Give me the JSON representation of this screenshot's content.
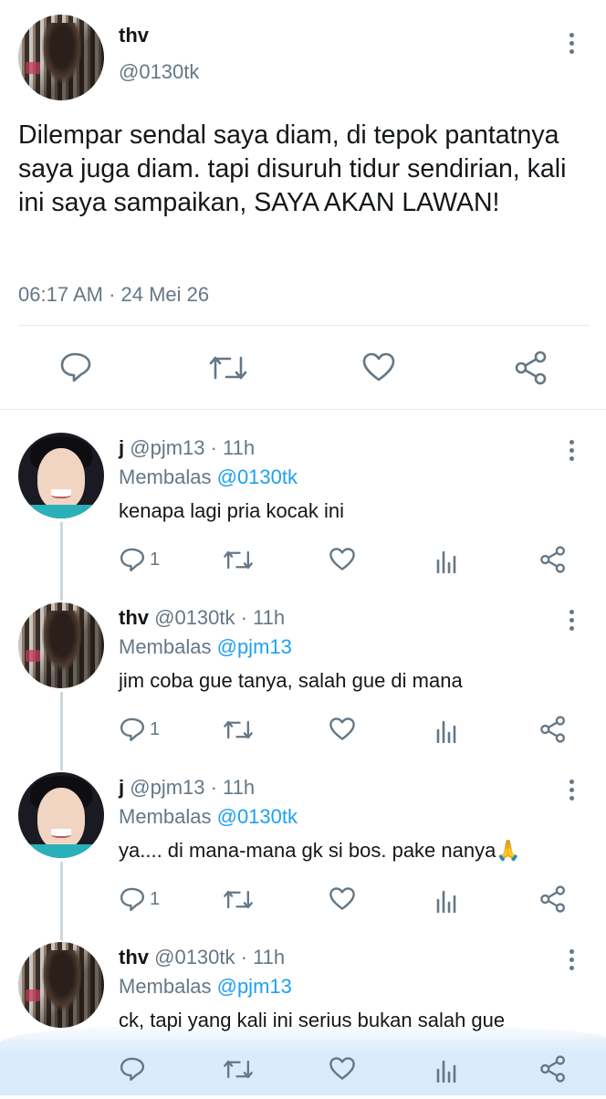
{
  "main_tweet": {
    "name": "thv",
    "handle": "@0130tk",
    "text": "Dilempar sendal saya diam, di tepok pantatnya saya juga diam. tapi disuruh tidur sendirian, kali ini saya sampaikan, SAYA AKAN LAWAN!",
    "timestamp": "06:17 AM · 24 Mei 26",
    "actions": [
      "reply-icon",
      "retweet-icon",
      "like-icon",
      "share-icon"
    ]
  },
  "replies": [
    {
      "name": "j",
      "handle": "@pjm13 · 11h",
      "replying_label": "Membalas",
      "replying_to": "@0130tk",
      "text": "kenapa lagi pria kocak ini",
      "reply_count": "1",
      "avatar": "jim"
    },
    {
      "name": "thv",
      "handle": "@0130tk · 11h",
      "replying_label": "Membalas",
      "replying_to": "@pjm13",
      "text": "jim coba gue tanya, salah gue di mana",
      "reply_count": "1",
      "avatar": "thv"
    },
    {
      "name": "j",
      "handle": "@pjm13 · 11h",
      "replying_label": "Membalas",
      "replying_to": "@0130tk",
      "text": "ya.... di mana-mana gk si bos. pake nanya🙏",
      "reply_count": "1",
      "avatar": "jim"
    },
    {
      "name": "thv",
      "handle": "@0130tk · 11h",
      "replying_label": "Membalas",
      "replying_to": "@pjm13",
      "text": "ck, tapi yang kali ini serius bukan salah gue",
      "reply_count": "",
      "avatar": "thv"
    }
  ],
  "colors": {
    "text": "#14171a",
    "secondary": "#657786",
    "accent": "#1da1f2",
    "divider": "#e6ecf0"
  }
}
